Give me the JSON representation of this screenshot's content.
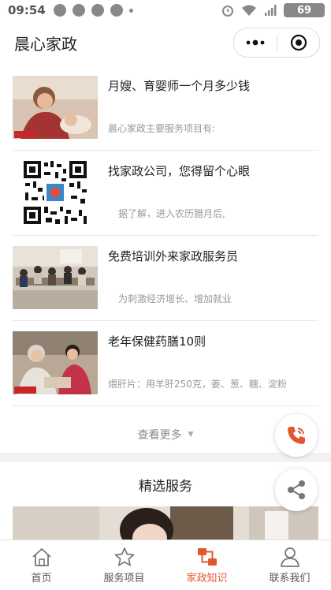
{
  "status_bar": {
    "time": "09:54",
    "battery": "69",
    "icons_left": [
      "wechat-icon",
      "message-icon",
      "paw-icon",
      "chat-icon",
      "dot-icon"
    ],
    "icons_right": [
      "alarm-icon",
      "wifi-icon",
      "signal-icon"
    ]
  },
  "navbar": {
    "title": "晨心家政",
    "capsule": [
      "more-icon",
      "close-target-icon"
    ]
  },
  "articles": [
    {
      "title": "月嫂、育婴师一个月多少钱",
      "subtitle": "晨心家政主要服务项目有:"
    },
    {
      "title": "找家政公司，您得留个心眼",
      "subtitle": "据了解，进入农历腊月后,"
    },
    {
      "title": "免费培训外来家政服务员",
      "subtitle": "为刺激经济增长、增加就业"
    },
    {
      "title": "老年保健药膳10则",
      "subtitle": "煨肝片：用羊肝250克，姜、葱、糖、淀粉"
    }
  ],
  "more_link": "查看更多",
  "featured": {
    "title": "精选服务"
  },
  "tabs": [
    {
      "label": "首页",
      "icon": "home-icon",
      "active": false
    },
    {
      "label": "服务项目",
      "icon": "star-icon",
      "active": false
    },
    {
      "label": "家政知识",
      "icon": "sitemap-icon",
      "active": true
    },
    {
      "label": "联系我们",
      "icon": "user-icon",
      "active": false
    }
  ],
  "colors": {
    "accent": "#e4572e",
    "text": "#222222",
    "muted": "#999999",
    "background": "#f2f2f2"
  }
}
